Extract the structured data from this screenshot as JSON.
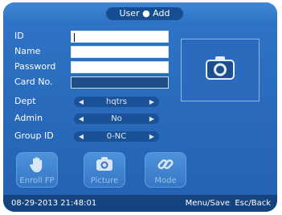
{
  "header": {
    "title": "User ● Add"
  },
  "form": {
    "id_label": "ID",
    "id_value": "",
    "name_label": "Name",
    "name_value": "",
    "password_label": "Password",
    "password_value": "",
    "card_label": "Card No.",
    "card_value": "",
    "dept_label": "Dept",
    "dept_value": "hqtrs",
    "admin_label": "Admin",
    "admin_value": "No",
    "group_label": "Group ID",
    "group_value": "0-NC"
  },
  "actions": {
    "enroll_fp": "Enroll FP",
    "picture": "Picture",
    "mode": "Mode"
  },
  "status": {
    "datetime": "08-29-2013 21:48:01",
    "hints": "Menu/Save  Esc/Back"
  },
  "colors": {
    "background": "#2a6bbd",
    "status_bar": "#14437f",
    "field": "#ffffff",
    "text": "#ffffff"
  },
  "icons": {
    "arrow_left": "left-triangle",
    "arrow_right": "right-triangle",
    "camera": "camera-icon",
    "hand": "hand-icon",
    "link": "link-icon"
  }
}
